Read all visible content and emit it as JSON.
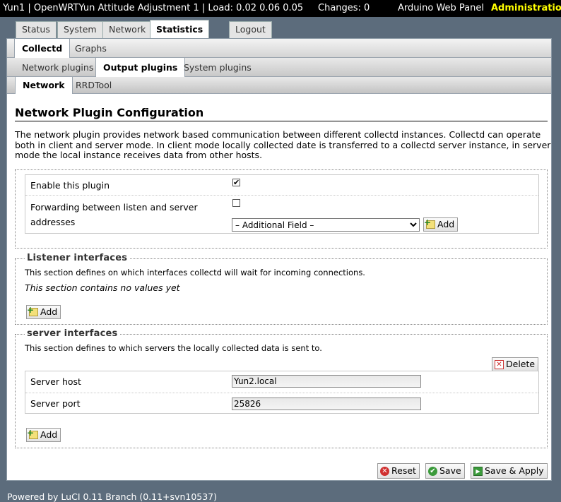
{
  "header": {
    "title": "Yun1 | OpenWRTYun Attitude Adjustment 1 | Load: 0.02 0.06 0.05",
    "changes": "Changes: 0",
    "web_panel": "Arduino Web Panel",
    "admin": "Administration"
  },
  "main_tabs": [
    "Status",
    "System",
    "Network",
    "Statistics",
    "Logout"
  ],
  "sub_tabs1": [
    "Collectd",
    "Graphs"
  ],
  "sub_tabs2": [
    "Network plugins",
    "Output plugins",
    "System plugins"
  ],
  "sub_tabs3": [
    "Network",
    "RRDTool"
  ],
  "page": {
    "title": "Network Plugin Configuration",
    "description": "The network plugin provides network based communication between different collectd instances. Collectd can operate both in client and server mode. In client mode locally collected date is transferred to a collectd server instance, in server mode the local instance receives data from other hosts."
  },
  "main_section": {
    "enable_label": "Enable this plugin",
    "enable_checked": true,
    "forward_label": "Forwarding between listen and server addresses",
    "forward_checked": false,
    "additional_field": "– Additional Field –",
    "add_label": "Add"
  },
  "listener": {
    "legend": "Listener interfaces",
    "description": "This section defines on which interfaces collectd will wait for incoming connections.",
    "empty": "This section contains no values yet",
    "add_label": "Add"
  },
  "server": {
    "legend": "server interfaces",
    "description": "This section defines to which servers the locally collected data is sent to.",
    "delete_label": "Delete",
    "host_label": "Server host",
    "host_value": "Yun2.local",
    "port_label": "Server port",
    "port_value": "25826",
    "add_label": "Add"
  },
  "actions": {
    "reset": "Reset",
    "save": "Save",
    "save_apply": "Save & Apply"
  },
  "footer": "Powered by LuCI 0.11 Branch (0.11+svn10537)"
}
